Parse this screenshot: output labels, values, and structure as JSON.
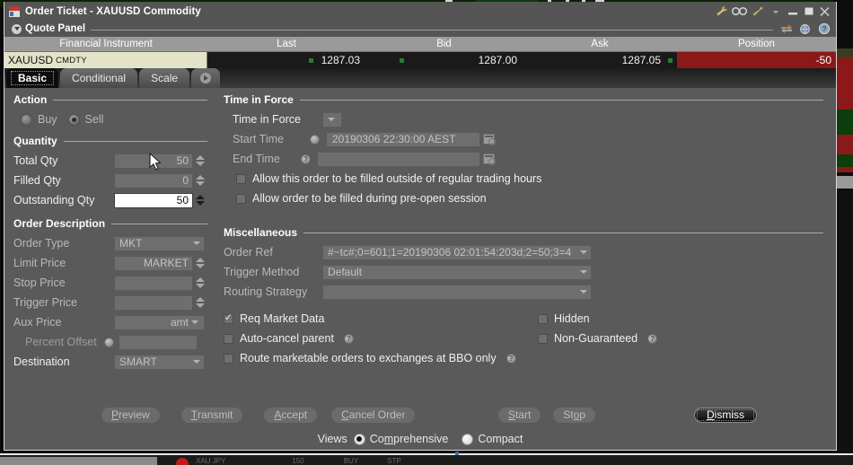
{
  "window": {
    "title": "Order Ticket - XAUUSD Commodity",
    "icon": "order-ticket-icon",
    "titlebar_icons": [
      "wrench-icon",
      "binoculars-icon",
      "pin-icon",
      "chevron-down-icon"
    ],
    "controls": [
      "minimize-button",
      "maximize-button",
      "close-button"
    ]
  },
  "quote_panel": {
    "title": "Quote Panel",
    "icons": [
      "swap-arrows-icon",
      "globe-icon",
      "help-icon"
    ],
    "columns": [
      "Financial Instrument",
      "Last",
      "Bid",
      "Ask",
      "Position"
    ],
    "row": {
      "instrument": "XAUUSD",
      "instrument_type": "CMDTY",
      "last": "1287.03",
      "bid": "1287.00",
      "ask": "1287.05",
      "position": "-50"
    },
    "colors": {
      "instrument_bg": "#e4e3c7",
      "position_bg": "#8c1919",
      "tick_green": "#2f7a2f"
    }
  },
  "tabs": [
    {
      "label": "Basic",
      "active": true
    },
    {
      "label": "Conditional",
      "active": false
    },
    {
      "label": "Scale",
      "active": false
    },
    {
      "label": "",
      "active": false,
      "icon": "more-tabs-arrow-icon"
    }
  ],
  "action": {
    "title": "Action",
    "options": [
      {
        "label": "Buy",
        "selected": false
      },
      {
        "label": "Sell",
        "selected": true
      }
    ]
  },
  "quantity": {
    "title": "Quantity",
    "fields": [
      {
        "label": "Total Qty",
        "value": "50",
        "enabled": false,
        "spinner": true
      },
      {
        "label": "Filled Qty",
        "value": "0",
        "enabled": false,
        "spinner": true
      },
      {
        "label": "Outstanding Qty",
        "value": "50",
        "enabled": true,
        "spinner": true
      }
    ]
  },
  "order_description": {
    "title": "Order Description",
    "fields": [
      {
        "label": "Order Type",
        "value": "MKT",
        "control": "dropdown",
        "enabled": false,
        "align": "left"
      },
      {
        "label": "Limit Price",
        "value": "MARKET",
        "control": "spinner",
        "enabled": false,
        "align": "right"
      },
      {
        "label": "Stop Price",
        "value": "",
        "control": "spinner",
        "enabled": false,
        "align": "right"
      },
      {
        "label": "Trigger Price",
        "value": "",
        "control": "spinner",
        "enabled": false,
        "align": "right"
      },
      {
        "label": "Aux Price",
        "value": "amt",
        "control": "dropdown",
        "enabled": false,
        "align": "right"
      },
      {
        "label": "Percent Offset",
        "value": "",
        "control": "plain",
        "enabled": false,
        "align": "right",
        "help": true
      },
      {
        "label": "Destination",
        "value": "SMART",
        "control": "dropdown",
        "enabled": false,
        "align": "left"
      }
    ]
  },
  "time_in_force": {
    "title": "Time in Force",
    "tif": {
      "label": "Time in Force",
      "value": ""
    },
    "start_time": {
      "label": "Start Time",
      "value": "20190306 22:30:00 AEST",
      "help": true
    },
    "end_time": {
      "label": "End Time",
      "value": "",
      "help": true
    },
    "checkboxes": [
      {
        "label": "Allow this order to be filled outside of regular trading hours",
        "checked": false
      },
      {
        "label": "Allow order to be filled during pre-open session",
        "checked": false
      }
    ]
  },
  "miscellaneous": {
    "title": "Miscellaneous",
    "fields": [
      {
        "label": "Order Ref",
        "value": "#~tc#;0=601;1=20190306 02:01:54:203d;2=50;3=4"
      },
      {
        "label": "Trigger Method",
        "value": "Default"
      },
      {
        "label": "Routing Strategy",
        "value": ""
      }
    ],
    "checkboxes_left": [
      {
        "label": "Req Market Data",
        "checked": true,
        "help": false
      },
      {
        "label": "Auto-cancel parent",
        "checked": false,
        "help": true
      },
      {
        "label": "Route marketable orders to exchanges at BBO only",
        "checked": false,
        "help": true
      }
    ],
    "checkboxes_right": [
      {
        "label": "Hidden",
        "checked": false,
        "help": false
      },
      {
        "label": "Non-Guaranteed",
        "checked": false,
        "help": true
      }
    ]
  },
  "buttons": [
    {
      "label": "Preview",
      "accel": "P",
      "primary": false
    },
    {
      "label": "Transmit",
      "accel": "T",
      "primary": false
    },
    {
      "label": "Accept",
      "accel": "A",
      "primary": false
    },
    {
      "label": "Cancel Order",
      "accel": "C",
      "primary": false
    },
    {
      "label": "Start",
      "accel": "S",
      "primary": false
    },
    {
      "label": "Stop",
      "accel": "o",
      "primary": false
    },
    {
      "label": "Dismiss",
      "accel": "D",
      "primary": true
    }
  ],
  "views": {
    "label": "Views",
    "options": [
      {
        "label": "Comprehensive",
        "selected": true
      },
      {
        "label": "Compact",
        "selected": false
      }
    ]
  }
}
